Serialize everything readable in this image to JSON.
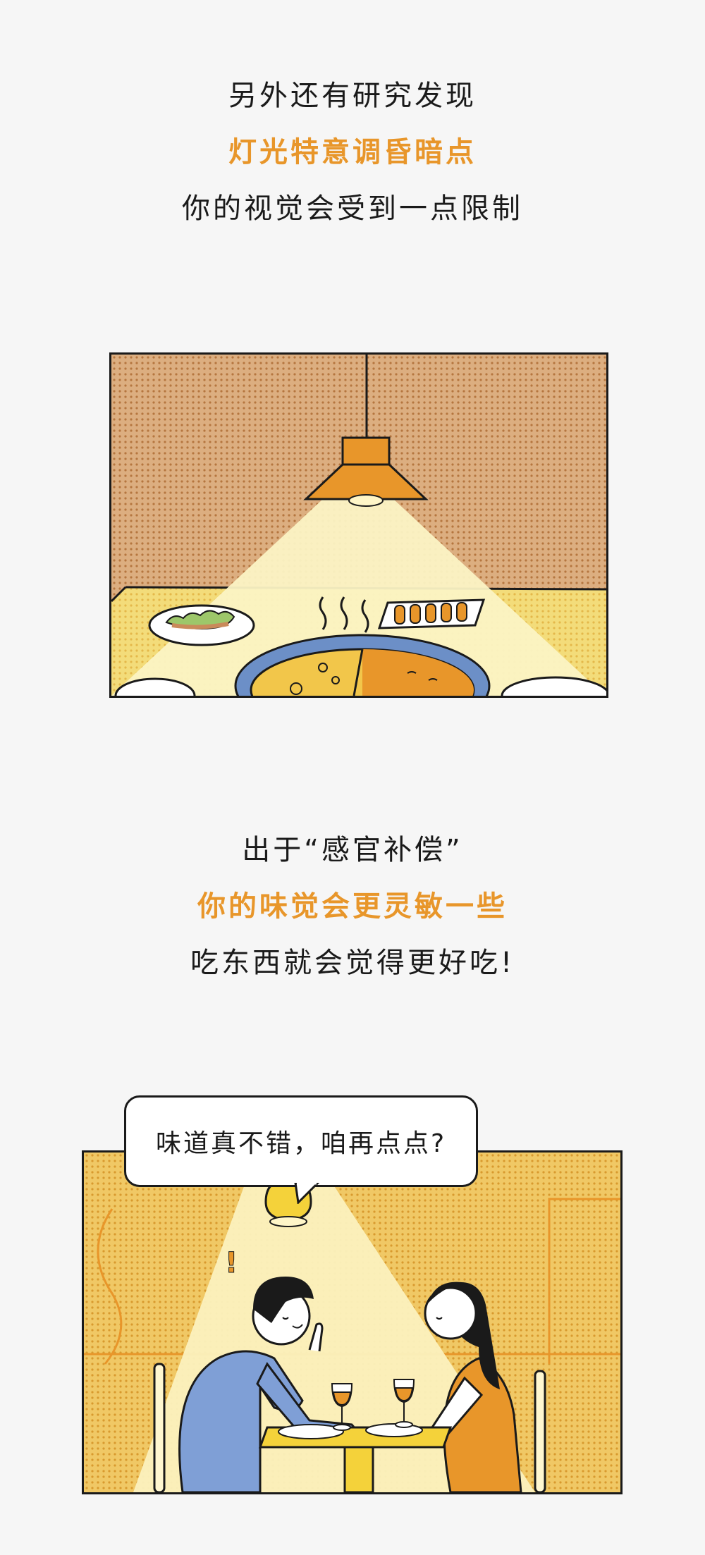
{
  "section1": {
    "line1": "另外还有研究发现",
    "line2": "灯光特意调昏暗点",
    "line3": "你的视觉会受到一点限制"
  },
  "section2": {
    "line1": "出于“感官补偿”",
    "line2": "你的味觉会更灵敏一些",
    "line3": "吃东西就会觉得更好吃!"
  },
  "speech_bubble": {
    "text": "味道真不错，咱再点点?"
  },
  "colors": {
    "accent": "#e8962a",
    "background": "#f6f6f6",
    "wall_tan": "#d9a979",
    "wall_yellow": "#eec46a",
    "light_cone": "#fbf3c4",
    "lamp_orange": "#e8962a"
  }
}
